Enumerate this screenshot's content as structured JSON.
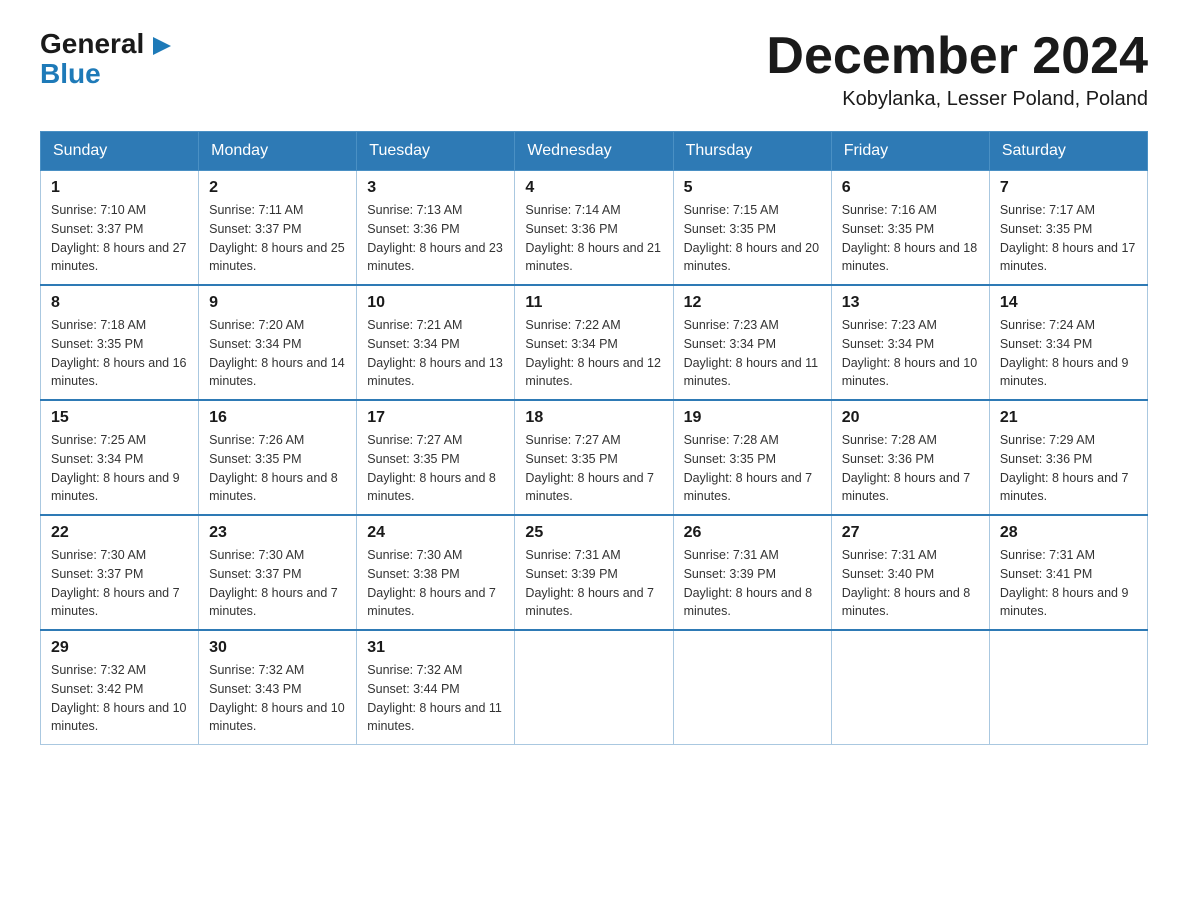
{
  "logo": {
    "general": "General",
    "arrow": "▶",
    "blue": "Blue"
  },
  "header": {
    "month_year": "December 2024",
    "location": "Kobylanka, Lesser Poland, Poland"
  },
  "days_of_week": [
    "Sunday",
    "Monday",
    "Tuesday",
    "Wednesday",
    "Thursday",
    "Friday",
    "Saturday"
  ],
  "weeks": [
    [
      {
        "day": "1",
        "sunrise": "7:10 AM",
        "sunset": "3:37 PM",
        "daylight": "8 hours and 27 minutes."
      },
      {
        "day": "2",
        "sunrise": "7:11 AM",
        "sunset": "3:37 PM",
        "daylight": "8 hours and 25 minutes."
      },
      {
        "day": "3",
        "sunrise": "7:13 AM",
        "sunset": "3:36 PM",
        "daylight": "8 hours and 23 minutes."
      },
      {
        "day": "4",
        "sunrise": "7:14 AM",
        "sunset": "3:36 PM",
        "daylight": "8 hours and 21 minutes."
      },
      {
        "day": "5",
        "sunrise": "7:15 AM",
        "sunset": "3:35 PM",
        "daylight": "8 hours and 20 minutes."
      },
      {
        "day": "6",
        "sunrise": "7:16 AM",
        "sunset": "3:35 PM",
        "daylight": "8 hours and 18 minutes."
      },
      {
        "day": "7",
        "sunrise": "7:17 AM",
        "sunset": "3:35 PM",
        "daylight": "8 hours and 17 minutes."
      }
    ],
    [
      {
        "day": "8",
        "sunrise": "7:18 AM",
        "sunset": "3:35 PM",
        "daylight": "8 hours and 16 minutes."
      },
      {
        "day": "9",
        "sunrise": "7:20 AM",
        "sunset": "3:34 PM",
        "daylight": "8 hours and 14 minutes."
      },
      {
        "day": "10",
        "sunrise": "7:21 AM",
        "sunset": "3:34 PM",
        "daylight": "8 hours and 13 minutes."
      },
      {
        "day": "11",
        "sunrise": "7:22 AM",
        "sunset": "3:34 PM",
        "daylight": "8 hours and 12 minutes."
      },
      {
        "day": "12",
        "sunrise": "7:23 AM",
        "sunset": "3:34 PM",
        "daylight": "8 hours and 11 minutes."
      },
      {
        "day": "13",
        "sunrise": "7:23 AM",
        "sunset": "3:34 PM",
        "daylight": "8 hours and 10 minutes."
      },
      {
        "day": "14",
        "sunrise": "7:24 AM",
        "sunset": "3:34 PM",
        "daylight": "8 hours and 9 minutes."
      }
    ],
    [
      {
        "day": "15",
        "sunrise": "7:25 AM",
        "sunset": "3:34 PM",
        "daylight": "8 hours and 9 minutes."
      },
      {
        "day": "16",
        "sunrise": "7:26 AM",
        "sunset": "3:35 PM",
        "daylight": "8 hours and 8 minutes."
      },
      {
        "day": "17",
        "sunrise": "7:27 AM",
        "sunset": "3:35 PM",
        "daylight": "8 hours and 8 minutes."
      },
      {
        "day": "18",
        "sunrise": "7:27 AM",
        "sunset": "3:35 PM",
        "daylight": "8 hours and 7 minutes."
      },
      {
        "day": "19",
        "sunrise": "7:28 AM",
        "sunset": "3:35 PM",
        "daylight": "8 hours and 7 minutes."
      },
      {
        "day": "20",
        "sunrise": "7:28 AM",
        "sunset": "3:36 PM",
        "daylight": "8 hours and 7 minutes."
      },
      {
        "day": "21",
        "sunrise": "7:29 AM",
        "sunset": "3:36 PM",
        "daylight": "8 hours and 7 minutes."
      }
    ],
    [
      {
        "day": "22",
        "sunrise": "7:30 AM",
        "sunset": "3:37 PM",
        "daylight": "8 hours and 7 minutes."
      },
      {
        "day": "23",
        "sunrise": "7:30 AM",
        "sunset": "3:37 PM",
        "daylight": "8 hours and 7 minutes."
      },
      {
        "day": "24",
        "sunrise": "7:30 AM",
        "sunset": "3:38 PM",
        "daylight": "8 hours and 7 minutes."
      },
      {
        "day": "25",
        "sunrise": "7:31 AM",
        "sunset": "3:39 PM",
        "daylight": "8 hours and 7 minutes."
      },
      {
        "day": "26",
        "sunrise": "7:31 AM",
        "sunset": "3:39 PM",
        "daylight": "8 hours and 8 minutes."
      },
      {
        "day": "27",
        "sunrise": "7:31 AM",
        "sunset": "3:40 PM",
        "daylight": "8 hours and 8 minutes."
      },
      {
        "day": "28",
        "sunrise": "7:31 AM",
        "sunset": "3:41 PM",
        "daylight": "8 hours and 9 minutes."
      }
    ],
    [
      {
        "day": "29",
        "sunrise": "7:32 AM",
        "sunset": "3:42 PM",
        "daylight": "8 hours and 10 minutes."
      },
      {
        "day": "30",
        "sunrise": "7:32 AM",
        "sunset": "3:43 PM",
        "daylight": "8 hours and 10 minutes."
      },
      {
        "day": "31",
        "sunrise": "7:32 AM",
        "sunset": "3:44 PM",
        "daylight": "8 hours and 11 minutes."
      },
      null,
      null,
      null,
      null
    ]
  ]
}
